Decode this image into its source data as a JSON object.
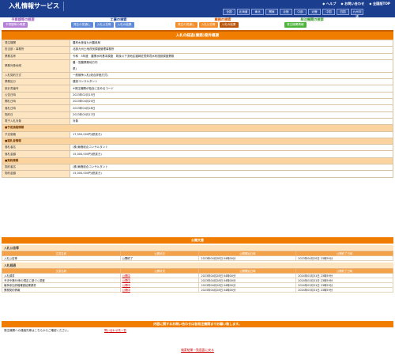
{
  "header": {
    "title": "入札情報サービス",
    "links": [
      "ヘルプ",
      "お問い合わせ",
      "全国版TOP"
    ],
    "regions": [
      "全国",
      "北海道",
      "東北",
      "関東",
      "北陸",
      "中部",
      "近畿",
      "中国",
      "四国",
      "九州沖縄"
    ]
  },
  "nav": {
    "groups": [
      {
        "title": "予算額等の概要",
        "tabs": [
          "予算額等の概要"
        ]
      },
      {
        "title": "工事の検索",
        "tabs": [
          "発注の見通し",
          "入札公告等",
          "入札の結果"
        ]
      },
      {
        "title": "業務の検索",
        "tabs": [
          "発注の見通し",
          "入札公告等",
          "入札の結果"
        ]
      },
      {
        "title": "発注機関の検索",
        "tabs": [
          "発注機関情報"
        ]
      }
    ]
  },
  "page": {
    "title": "入札の経過(業務)案件概要",
    "rows": [
      {
        "label": "発注機関",
        "value": "農林水産省九州農政局"
      },
      {
        "label": "担当部・事務所",
        "value": "北部九州土地改良調査管理事務所"
      },
      {
        "label": "業務名称",
        "value": "令和　5年度　農業水利基本調査　筑後川下流地区福岡佐賀県境水利施設調査業務"
      },
      {
        "label": "業務対象地域",
        "value": "農・営農業務地方内",
        "value2": "県)"
      },
      {
        "label": "入札契約方式",
        "value": "一般競争入札(総合評価方式)"
      },
      {
        "label": "業務区分",
        "value": "建設コンサルタント"
      },
      {
        "label": "設計書番号",
        "value": "※発注機関が独自に定めるコード"
      },
      {
        "label": "公告日時",
        "value": "2023年02月15日"
      },
      {
        "label": "開札日時",
        "value": "2023年04月20日"
      },
      {
        "label": "落札日時",
        "value": "2023年04月28日"
      },
      {
        "label": "契約日",
        "value": "2023年05月17日"
      },
      {
        "label": "電子入札対象",
        "value": "対象"
      },
      {
        "section": "■予定価格情報"
      },
      {
        "label": "予定価格",
        "value": "17,550,000円(税抜き)"
      },
      {
        "section": "■落札者情報"
      },
      {
        "label": "落札者名",
        "value": "(株)東峰総合コンサルタント"
      },
      {
        "label": "落札金額",
        "value": "15,000,000円(税抜き)"
      },
      {
        "section": "■契約情報"
      },
      {
        "label": "契約者名",
        "value": "(株)東峰総合コンサルタント"
      },
      {
        "label": "契約金額",
        "value": "15,000,000円(税抜き)"
      }
    ]
  },
  "publications": {
    "title": "公開文書",
    "columns": [
      "文書名称",
      "公開状況",
      "公開開始日時",
      "公開終了日時"
    ],
    "sections": [
      {
        "name": "入札公告等",
        "rows": [
          [
            "入札公告等",
            "公開終了",
            "2023年04月28日 04時00分",
            "2023年04月20日 23時59分"
          ]
        ]
      },
      {
        "name": "入札経過",
        "rows": [
          [
            "入札調書",
            "公開中",
            "2023年04月28日 04時00分",
            "2024年03月31日 23時59分"
          ],
          [
            "予決令第85条の規定に基づく調査",
            "公開中",
            "2023年04月28日 04時00分",
            "2024年03月31日 23時59分"
          ],
          [
            "競争参加資格確認結果調書",
            "公開中",
            "2023年04月28日 04時00分",
            "2024年03月31日 23時59分"
          ],
          [
            "業務契約情報",
            "公開中",
            "2023年04月28日 04時00分",
            "2024年03月31日 23時59分"
          ]
        ]
      }
    ]
  },
  "contact": {
    "title": "内容に関するお問い合わせは各発注機関までお願い致します。",
    "text": "発注機関への連絡先等はこちらからご確認ください。",
    "link": "問い合わせ先一覧"
  },
  "back_link": "検索結果一覧画面に戻る",
  "colors": {
    "header": "#1c3e8e",
    "accent": "#f07d00",
    "label_bg": "#fde5c2"
  }
}
